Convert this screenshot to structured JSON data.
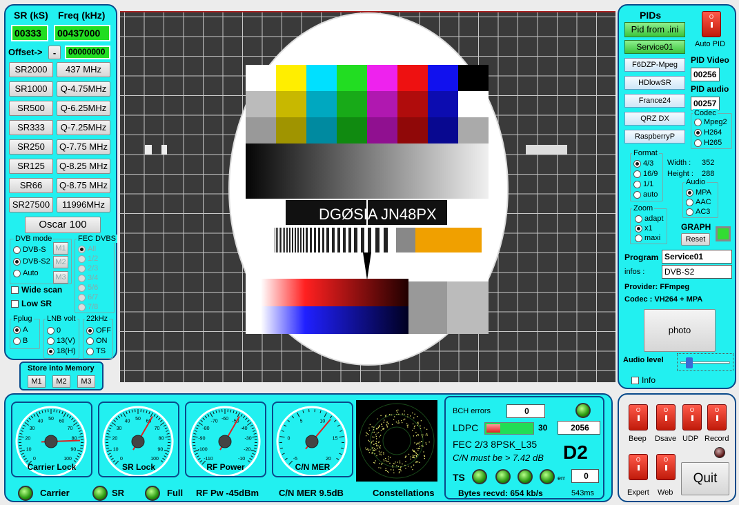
{
  "left": {
    "sr_label": "SR (kS)",
    "freq_label": "Freq (kHz)",
    "sr_value": "00333",
    "freq_value": "00437000",
    "offset_label": "Offset->",
    "offset_sign": "-",
    "offset_value": "00000000",
    "sr_buttons": [
      "SR2000",
      "SR1000",
      "SR500",
      "SR333",
      "SR250",
      "SR125",
      "SR66",
      "SR27500"
    ],
    "freq_buttons": [
      "437 MHz",
      "Q-4.75MHz",
      "Q-6.25MHz",
      "Q-7.25MHz",
      "Q-7.75 MHz",
      "Q-8.25 MHz",
      "Q-8.75 MHz",
      "11996MHz"
    ],
    "preset_button": "Oscar 100",
    "dvb_mode": {
      "title": "DVB mode",
      "options": [
        "DVB-S",
        "DVB-S2",
        "Auto"
      ],
      "selected": "DVB-S2"
    },
    "mem_side": [
      "M1",
      "M2",
      "M3"
    ],
    "fec": {
      "title": "FEC DVBS",
      "options": [
        "All",
        "1/2",
        "2/3",
        "3/4",
        "5/6",
        "6/7",
        "7/8"
      ]
    },
    "wide_scan": "Wide scan",
    "low_sr": "Low SR",
    "fplug": {
      "title": "Fplug",
      "options": [
        "A",
        "B"
      ],
      "selected": "A"
    },
    "lnb": {
      "title": "LNB volt",
      "options": [
        "0",
        "13(V)",
        "18(H)"
      ],
      "selected": "18(H)"
    },
    "khz22": {
      "title": "22kHz",
      "options": [
        "OFF",
        "ON",
        "TS"
      ],
      "selected": "OFF"
    },
    "store": {
      "title": "Store into Memory",
      "buttons": [
        "M1",
        "M2",
        "M3"
      ]
    }
  },
  "video": {
    "callsign": "DGØSIA",
    "locator": "JN48PX"
  },
  "right": {
    "pids_title": "PIDs",
    "pid_from_ini": "Pid from .ini",
    "service_buttons": [
      "Service01",
      "F6DZP-Mpeg",
      "HDlowSR",
      "France24",
      "QRZ DX",
      "RaspberryP"
    ],
    "auto_pid": "Auto PID",
    "pid_video_label": "PID Video",
    "pid_video": "00256",
    "pid_audio_label": "PID audio",
    "pid_audio": "00257",
    "codec": {
      "title": "Codec",
      "options": [
        "Mpeg2",
        "H264",
        "H265"
      ],
      "selected": "H264"
    },
    "format": {
      "title": "Format",
      "options": [
        "4/3",
        "16/9",
        "1/1",
        "auto"
      ],
      "selected": "4/3"
    },
    "width_label": "Width :",
    "width_value": "352",
    "height_label": "Height :",
    "height_value": "288",
    "audio": {
      "title": "Audio",
      "options": [
        "MPA",
        "AAC",
        "AC3"
      ],
      "selected": "MPA"
    },
    "zoom": {
      "title": "Zoom",
      "options": [
        "adapt",
        "x1",
        "maxi"
      ],
      "selected": "x1"
    },
    "graph_label": "GRAPH",
    "reset_label": "Reset",
    "program_label": "Program",
    "program_value": "Service01",
    "infos_label": "infos :",
    "infos_value": "DVB-S2",
    "provider": "Provider: FFmpeg",
    "codec_line": "Codec :   VH264 + MPA",
    "photo_label": "photo",
    "audio_level_label": "Audio level",
    "audio_level": 0.12,
    "info_label": "Info"
  },
  "bottom": {
    "gauges": [
      {
        "label": "Carrier Lock",
        "scale": [
          "0",
          "10",
          "20",
          "30",
          "40",
          "50",
          "60",
          "70",
          "80",
          "90",
          "100"
        ]
      },
      {
        "label": "SR Lock",
        "scale": [
          "0",
          "10",
          "20",
          "30",
          "40",
          "50",
          "60",
          "70",
          "80",
          "90",
          "100"
        ]
      },
      {
        "label": "RF Power",
        "scale": [
          "-110",
          "-100",
          "-90",
          "-80",
          "-70",
          "-60",
          "-50",
          "-40",
          "-30",
          "-20",
          "-10"
        ]
      },
      {
        "label": "C/N MER",
        "scale": [
          "-5",
          "0",
          "5",
          "10",
          "15",
          "20"
        ]
      }
    ],
    "carrier_label": "Carrier",
    "sr_label": "SR",
    "full_label": "Full",
    "rf_pw": "RF Pw -45dBm",
    "cn_mer": "C/N MER 9.5dB",
    "constellations": "Constellations"
  },
  "status": {
    "bch_label": "BCH errors",
    "bch_value": "0",
    "ldpc_label": "LDPC",
    "ldpc_count": "30",
    "ldpc_value": "2056",
    "fec_line": "FEC  2/3 8PSK_L35",
    "cn_line": "C/N must be > 7.42 dB",
    "d2": "D2",
    "ts_label": "TS",
    "err_label": "err",
    "err_value": "0",
    "bytes_line": "Bytes recvd:  654 kb/s",
    "ms": "543ms"
  },
  "toggles": {
    "top": [
      "Beep",
      "Dsave",
      "UDP",
      "Record"
    ],
    "bottom": [
      "Expert",
      "Web"
    ],
    "quit": "Quit"
  },
  "colors": {
    "panel": "#22f0f0",
    "border": "#0a4a8a",
    "green_field": "#22dd22"
  }
}
